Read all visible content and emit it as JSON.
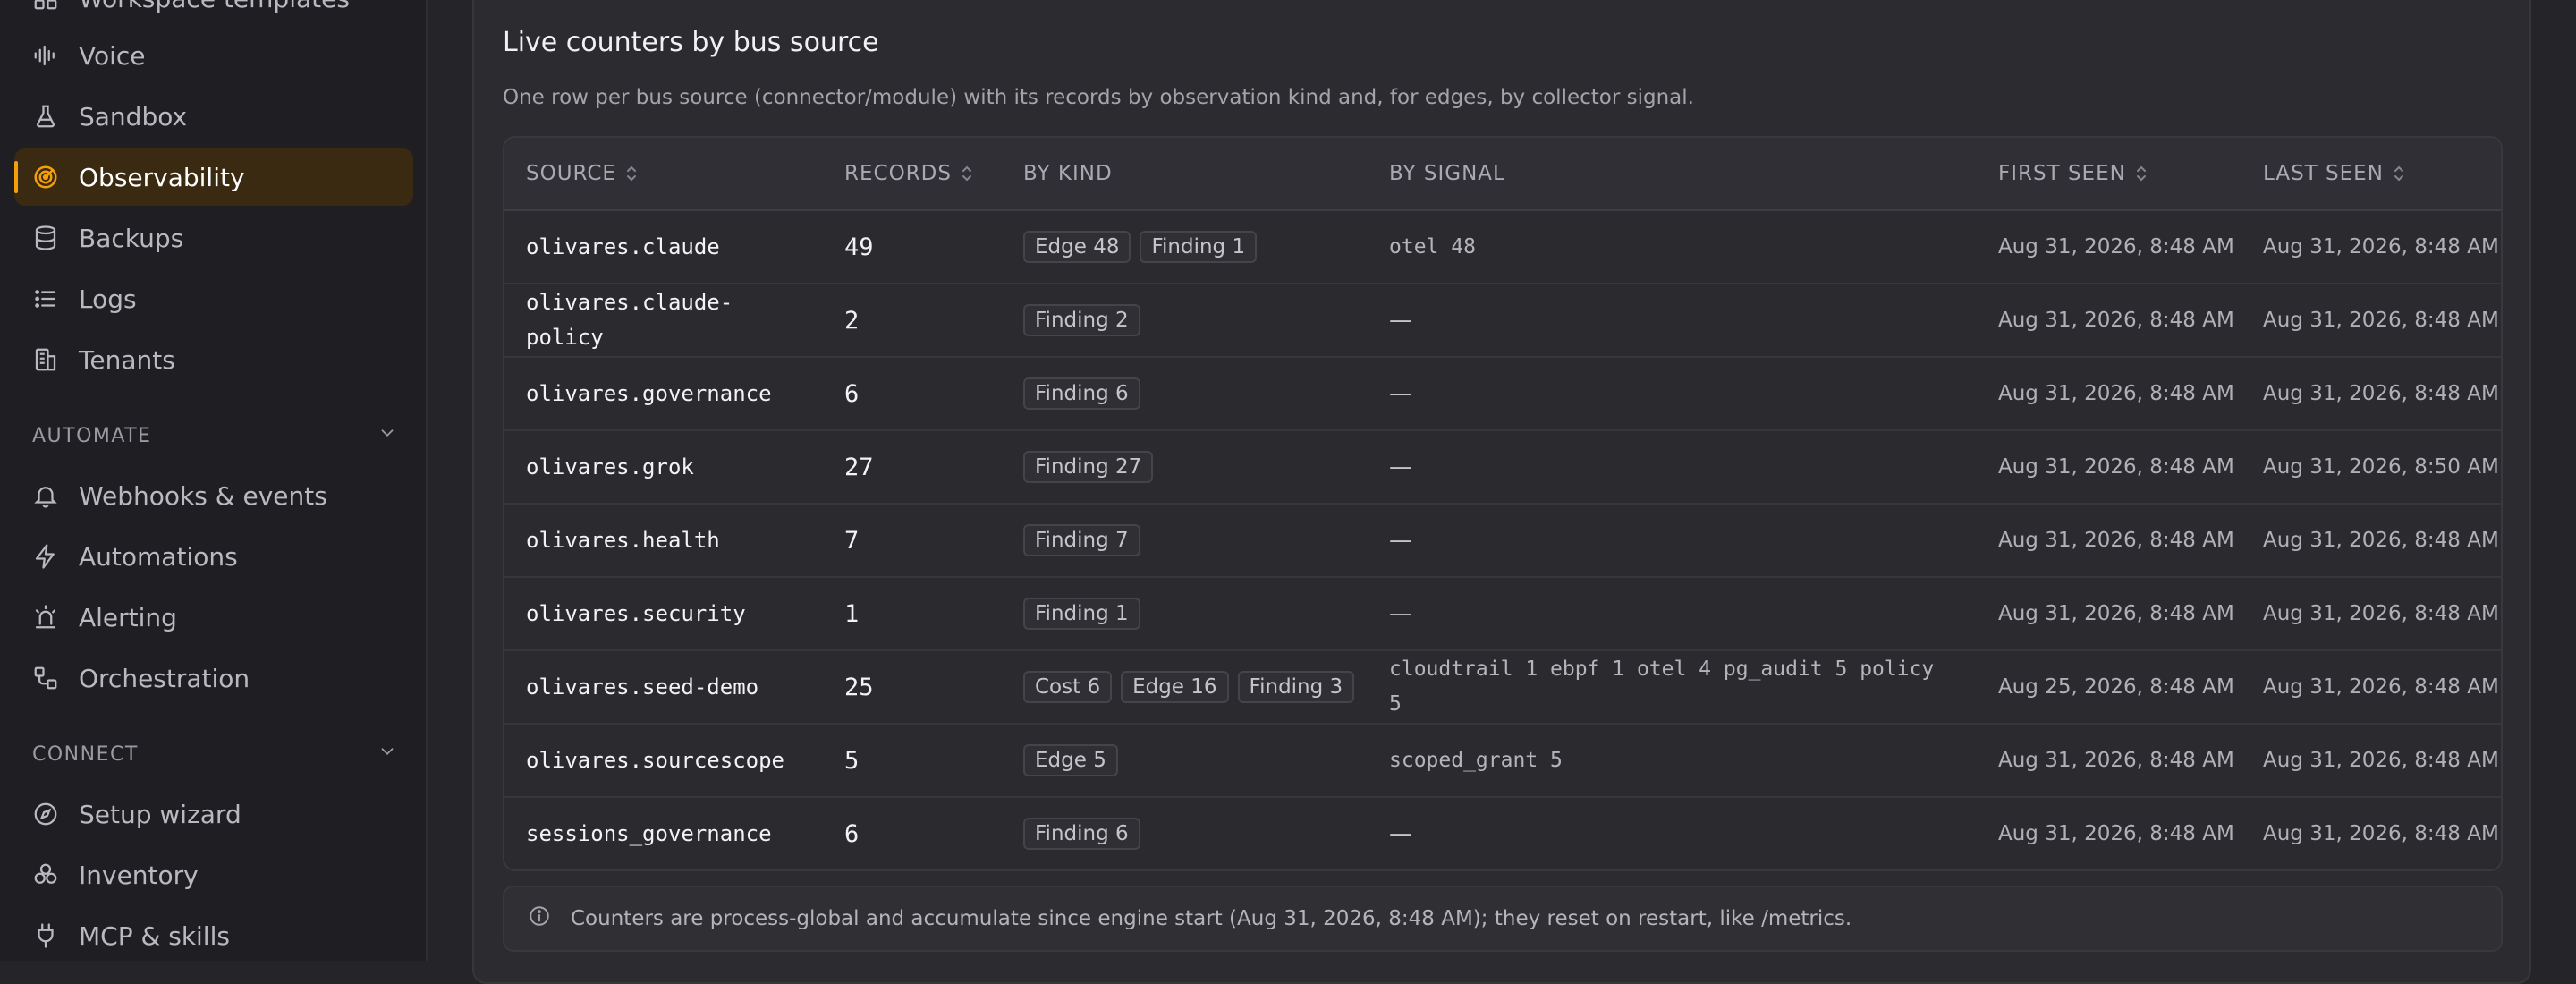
{
  "sidebar": {
    "partial_item": "Workspace templates",
    "items": [
      {
        "label": "Voice",
        "icon": "waveform-icon"
      },
      {
        "label": "Sandbox",
        "icon": "flask-icon"
      },
      {
        "label": "Observability",
        "icon": "radar-icon",
        "active": true
      },
      {
        "label": "Backups",
        "icon": "database-icon"
      },
      {
        "label": "Logs",
        "icon": "list-icon"
      },
      {
        "label": "Tenants",
        "icon": "building-icon"
      }
    ],
    "automate": {
      "title": "AUTOMATE",
      "items": [
        {
          "label": "Webhooks & events",
          "icon": "bell-icon"
        },
        {
          "label": "Automations",
          "icon": "lightning-icon"
        },
        {
          "label": "Alerting",
          "icon": "siren-icon"
        },
        {
          "label": "Orchestration",
          "icon": "workflow-icon"
        }
      ]
    },
    "connect": {
      "title": "CONNECT",
      "items": [
        {
          "label": "Setup wizard",
          "icon": "compass-icon"
        },
        {
          "label": "Inventory",
          "icon": "boxes-icon"
        },
        {
          "label": "MCP & skills",
          "icon": "plug-icon"
        }
      ]
    }
  },
  "panel": {
    "title": "Live counters by bus source",
    "description": "One row per bus source (connector/module) with its records by observation kind and, for edges, by collector signal.",
    "columns": {
      "source": "SOURCE",
      "records": "RECORDS",
      "by_kind": "BY KIND",
      "by_signal": "BY SIGNAL",
      "first_seen": "FIRST SEEN",
      "last_seen": "LAST SEEN"
    },
    "rows": [
      {
        "source": "olivares.claude",
        "records": "49",
        "kinds": [
          "Edge 48",
          "Finding 1"
        ],
        "signal": "otel 48",
        "first_seen": "Aug 31, 2026, 8:48 AM",
        "last_seen": "Aug 31, 2026, 8:48 AM"
      },
      {
        "source": "olivares.claude-policy",
        "records": "2",
        "kinds": [
          "Finding 2"
        ],
        "signal": "—",
        "first_seen": "Aug 31, 2026, 8:48 AM",
        "last_seen": "Aug 31, 2026, 8:48 AM"
      },
      {
        "source": "olivares.governance",
        "records": "6",
        "kinds": [
          "Finding 6"
        ],
        "signal": "—",
        "first_seen": "Aug 31, 2026, 8:48 AM",
        "last_seen": "Aug 31, 2026, 8:48 AM"
      },
      {
        "source": "olivares.grok",
        "records": "27",
        "kinds": [
          "Finding 27"
        ],
        "signal": "—",
        "first_seen": "Aug 31, 2026, 8:48 AM",
        "last_seen": "Aug 31, 2026, 8:50 AM"
      },
      {
        "source": "olivares.health",
        "records": "7",
        "kinds": [
          "Finding 7"
        ],
        "signal": "—",
        "first_seen": "Aug 31, 2026, 8:48 AM",
        "last_seen": "Aug 31, 2026, 8:48 AM"
      },
      {
        "source": "olivares.security",
        "records": "1",
        "kinds": [
          "Finding 1"
        ],
        "signal": "—",
        "first_seen": "Aug 31, 2026, 8:48 AM",
        "last_seen": "Aug 31, 2026, 8:48 AM"
      },
      {
        "source": "olivares.seed-demo",
        "records": "25",
        "kinds": [
          "Cost 6",
          "Edge 16",
          "Finding 3"
        ],
        "signal": "cloudtrail 1 ebpf 1 otel 4 pg_audit 5 policy 5",
        "first_seen": "Aug 25, 2026, 8:48 AM",
        "last_seen": "Aug 31, 2026, 8:48 AM"
      },
      {
        "source": "olivares.sourcescope",
        "records": "5",
        "kinds": [
          "Edge 5"
        ],
        "signal": "scoped_grant 5",
        "first_seen": "Aug 31, 2026, 8:48 AM",
        "last_seen": "Aug 31, 2026, 8:48 AM"
      },
      {
        "source": "sessions_governance",
        "records": "6",
        "kinds": [
          "Finding 6"
        ],
        "signal": "—",
        "first_seen": "Aug 31, 2026, 8:48 AM",
        "last_seen": "Aug 31, 2026, 8:48 AM"
      }
    ],
    "footnote": "Counters are process-global and accumulate since engine start (Aug 31, 2026, 8:48 AM); they reset on restart, like /metrics."
  },
  "colors": {
    "accent": "#f59e0b",
    "active_bg": "#3a2a12",
    "sidebar_bg": "#1f1f23",
    "main_bg": "#252529"
  }
}
